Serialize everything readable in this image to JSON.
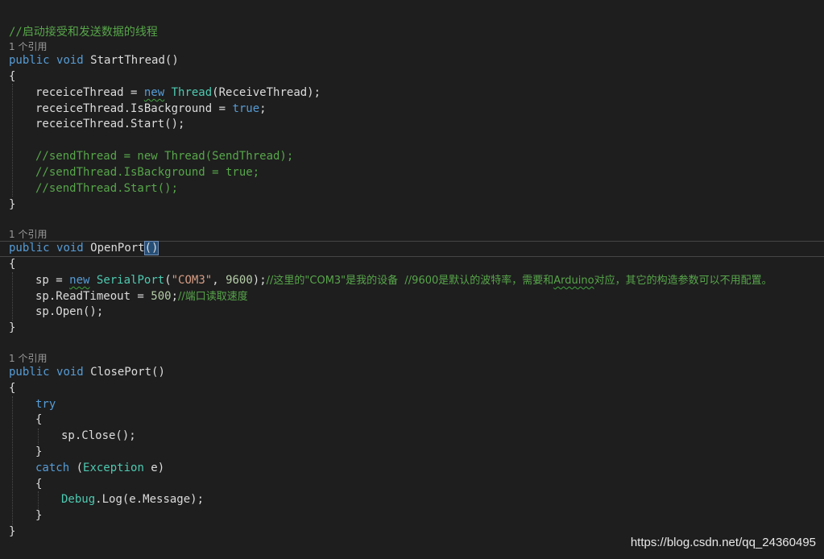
{
  "editor": {
    "codelens_label": "1 个引用",
    "blocks": {
      "start_thread": {
        "comment": "//启动接受和发送数据的线程",
        "kw_public": "public",
        "kw_void": "void",
        "name": "StartThread()",
        "open_brace": "{",
        "l1_a": "receiceThread = ",
        "l1_new": "new",
        "l1_type": "Thread",
        "l1_b": "(ReceiveThread);",
        "l2_a": "receiceThread.IsBackground = ",
        "l2_true": "true",
        "l2_b": ";",
        "l3": "receiceThread.Start();",
        "c1": "//sendThread = new Thread(SendThread);",
        "c2": "//sendThread.IsBackground = true;",
        "c3": "//sendThread.Start();",
        "close_brace": "}"
      },
      "open_port": {
        "kw_public": "public",
        "kw_void": "void",
        "name": "OpenPort",
        "paren": "()",
        "open_brace": "{",
        "l1_a": "sp = ",
        "l1_new": "new",
        "l1_type": "SerialPort",
        "l1_p": "(",
        "l1_str": "\"COM3\"",
        "l1_comma": ", ",
        "l1_num": "9600",
        "l1_end": ");",
        "l1_cm1": "//这里的\"COM3\"是我的设备  //9600是默认的波特率，需要和",
        "l1_cm_arduino": "Arduino",
        "l1_cm2": "对应，其它的构造参数可以不用配置。",
        "l2_a": "sp.ReadTimeout = ",
        "l2_num": "500",
        "l2_semi": ";",
        "l2_cm": "//端口读取速度",
        "l3": "sp.Open();",
        "close_brace": "}"
      },
      "close_port": {
        "kw_public": "public",
        "kw_void": "void",
        "name": "ClosePort()",
        "open_brace": "{",
        "kw_try": "try",
        "try_open": "{",
        "try_body": "sp.Close();",
        "try_close": "}",
        "kw_catch": "catch",
        "catch_p1": " (",
        "catch_type": "Exception",
        "catch_p2": " e)",
        "catch_open": "{",
        "catch_type2": "Debug",
        "catch_body": ".Log(e.Message);",
        "catch_close": "}",
        "close_brace": "}"
      }
    }
  },
  "watermark": "https://blog.csdn.net/qq_24360495",
  "colors": {
    "background": "#1e1e1e",
    "keyword": "#569cd6",
    "type": "#4ec9b0",
    "comment": "#57a64a",
    "string": "#d69d85",
    "number": "#b5cea8",
    "text": "#dcdcdc"
  }
}
